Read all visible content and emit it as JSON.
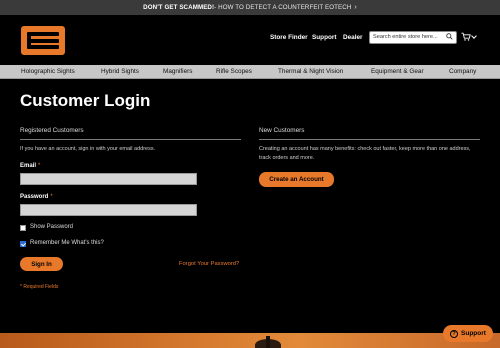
{
  "announcement": {
    "bold": "DON'T GET SCAMMED!",
    "text": " - HOW TO DETECT A COUNTERFEIT EOTECH",
    "chevron": "›"
  },
  "header": {
    "logo_icon": "eotech-logo",
    "links": [
      "Store Finder",
      "Support",
      "Dealer"
    ],
    "search_placeholder": "Search entire store here...",
    "cart_icon": "cart-icon"
  },
  "nav": {
    "items": [
      "Holographic Sights",
      "Hybrid Sights",
      "Magnifiers",
      "Rifle Scopes",
      "Thermal & Night Vision",
      "Equipment & Gear",
      "Company"
    ]
  },
  "page": {
    "title": "Customer Login"
  },
  "registered": {
    "heading": "Registered Customers",
    "intro": "If you have an account, sign in with your email address.",
    "email_label": "Email",
    "password_label": "Password",
    "required_mark": "*",
    "show_password": "Show Password",
    "remember_me": "Remember Me What's this?",
    "sign_in": "Sign In",
    "forgot": "Forgot Your Password?",
    "required_note": "* Required Fields"
  },
  "new_customers": {
    "heading": "New Customers",
    "text": "Creating an account has many benefits: check out faster, keep more than one address, track orders and more.",
    "button": "Create an Account"
  },
  "support": {
    "label": "Support",
    "icon": "?"
  },
  "colors": {
    "accent": "#e8792b",
    "nav_bg": "#c7c7c7",
    "topbar_bg": "#3a3a3a",
    "page_bg": "#000000"
  }
}
